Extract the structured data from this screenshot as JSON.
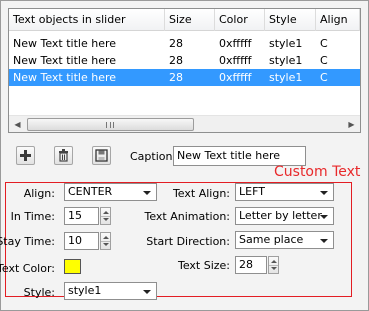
{
  "table": {
    "columns": [
      "Text objects in slider",
      "Size",
      "Color",
      "Style",
      "Align"
    ],
    "rows": [
      [
        "New Text title here",
        "28",
        "0xfffff",
        "style1",
        "C"
      ],
      [
        "New Text title here",
        "28",
        "0xfffff",
        "style1",
        "C"
      ],
      [
        "New Text title here",
        "28",
        "0xfffff",
        "style1",
        "C"
      ]
    ],
    "selected_row": 2
  },
  "toolbar": {
    "add_icon": "plus-icon",
    "delete_icon": "trash-icon",
    "save_icon": "floppy-disk-icon",
    "caption_label": "Caption:",
    "caption_value": "New Text title here"
  },
  "custom_text": {
    "title": "Custom Text",
    "align_label": "Align:",
    "align_value": "CENTER",
    "in_time_label": "In Time:",
    "in_time_value": "15",
    "stay_time_label": "Stay Time:",
    "stay_time_value": "10",
    "text_color_label": "Text Color:",
    "text_color_value": "#ffff00",
    "style_label": "Style:",
    "style_value": "style1",
    "text_align_label": "Text Align:",
    "text_align_value": "LEFT",
    "text_animation_label": "Text Animation:",
    "text_animation_value": "Letter by letter",
    "start_direction_label": "Start Direction:",
    "start_direction_value": "Same place",
    "text_size_label": "Text Size:",
    "text_size_value": "28"
  },
  "colors": {
    "selection": "#3399ff",
    "group_border": "#e31d23",
    "title_red": "#e8292b"
  }
}
